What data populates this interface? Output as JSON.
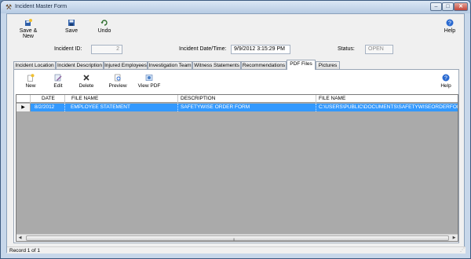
{
  "window": {
    "title": "Incident Master Form",
    "minimize": "–",
    "maximize": "□",
    "close": "✕"
  },
  "toolbar": {
    "save_new": "Save & New",
    "save": "Save",
    "undo": "Undo",
    "help": "Help"
  },
  "fields": {
    "incident_id_label": "Incident ID:",
    "incident_id_value": "2",
    "incident_datetime_label": "Incident Date/Time:",
    "incident_datetime_value": "9/9/2012 3:15:29 PM",
    "status_label": "Status:",
    "status_value": "OPEN"
  },
  "tabs": [
    {
      "label": "Incident Location"
    },
    {
      "label": "Incident Description"
    },
    {
      "label": "Injured Employees"
    },
    {
      "label": "Investigation Team"
    },
    {
      "label": "Witness Statements"
    },
    {
      "label": "Recommendations"
    },
    {
      "label": "PDF Files"
    },
    {
      "label": "Pictures"
    }
  ],
  "active_tab": "PDF Files",
  "subtoolbar": {
    "new": "New",
    "edit": "Edit",
    "delete": "Delete",
    "preview": "Preview",
    "view_pdf": "View PDF",
    "help": "Help"
  },
  "grid": {
    "columns": [
      "DATE",
      "FILE NAME",
      "DESCRIPTION",
      "FILE NAME"
    ],
    "rows": [
      [
        "8/2/2012",
        "EMPLOYEE STATEMENT",
        "SAFETYWISE ORDER FORM",
        "C:\\USERS\\PUBLIC\\DOCUMENTS\\SAFETYWISEORDERFORM.PDF"
      ]
    ],
    "selection_color": "#3399ff"
  },
  "status": {
    "text": "Record 1 of 1"
  },
  "icons": {
    "app": "tools-icon",
    "save_new": "save-new-icon",
    "save": "floppy-disk-icon",
    "undo": "undo-arrow-icon",
    "help": "help-icon",
    "new": "new-document-icon",
    "edit": "edit-icon",
    "delete": "delete-x-icon",
    "preview": "preview-icon",
    "view_pdf": "view-pdf-icon"
  }
}
